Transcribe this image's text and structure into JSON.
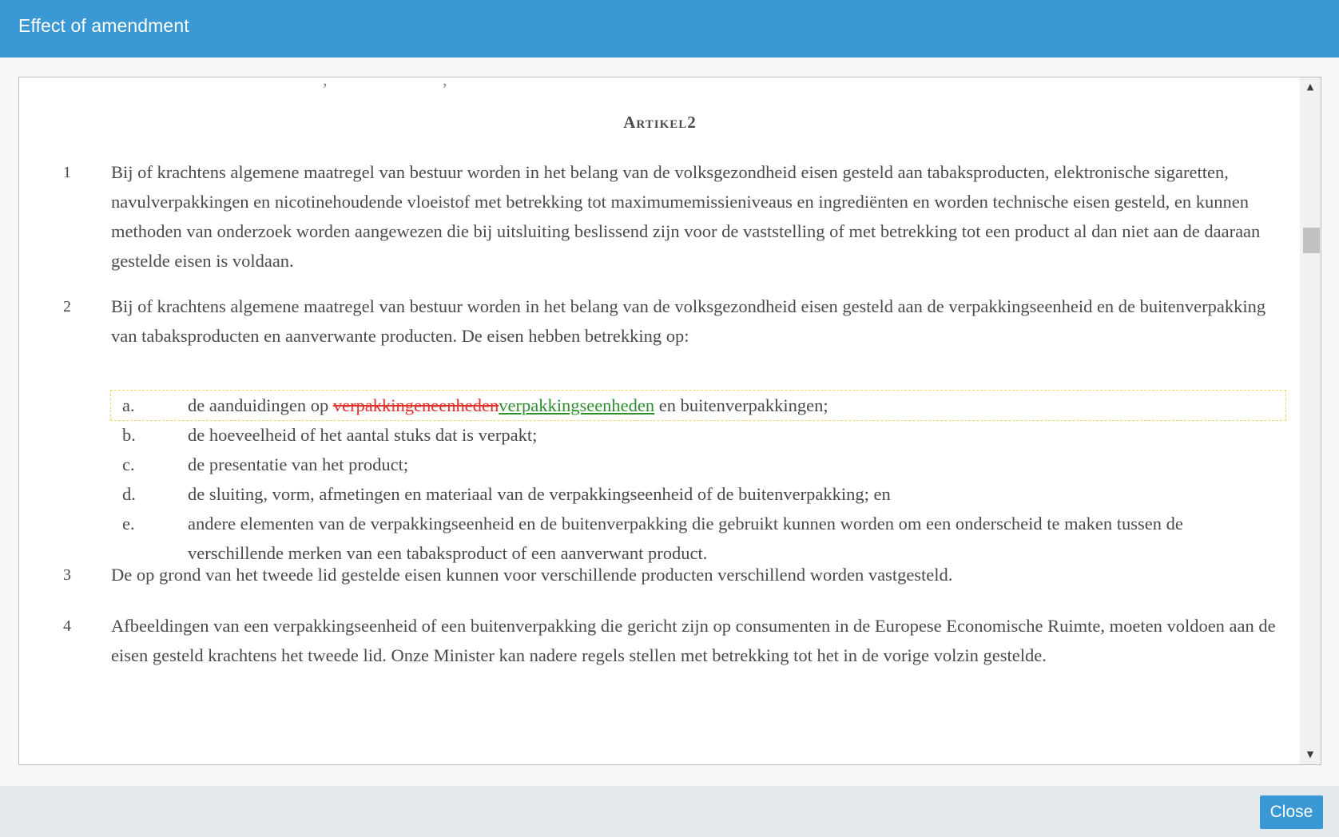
{
  "dialog": {
    "title": "Effect of amendment",
    "close_label": "Close"
  },
  "document": {
    "article_heading": "Artikel2",
    "members": [
      {
        "number": "1",
        "text": "Bij of krachtens algemene maatregel van bestuur worden in het belang van de volksgezondheid eisen gesteld aan tabaksproducten, elektronische sigaretten, navulverpakkingen en nicotinehoudende vloeistof met betrekking tot maximumemissieniveaus en ingrediënten en worden technische eisen gesteld, en kunnen methoden van onderzoek worden aangewezen die bij uitsluiting beslissend zijn voor de vaststelling of met betrekking tot een product al dan niet aan de daaraan gestelde eisen is voldaan."
      },
      {
        "number": "2",
        "text": "Bij of krachtens algemene maatregel van bestuur worden in het belang van de volksgezondheid eisen gesteld aan de verpakkingseenheid en de buitenverpakking van tabaksproducten en aanverwante producten. De eisen hebben betrekking op:",
        "items": [
          {
            "label": "a.",
            "prefix": "de aanduidingen op ",
            "deleted": "verpakkingeneenheden",
            "inserted": "verpakkingseenheden",
            "suffix": " en buitenverpakkingen;"
          },
          {
            "label": "b.",
            "text": "de hoeveelheid of het aantal stuks dat is verpakt;"
          },
          {
            "label": "c.",
            "text": "de presentatie van het product;"
          },
          {
            "label": "d.",
            "text": "de sluiting, vorm, afmetingen en materiaal van de verpakkingseenheid of de buitenverpakking; en"
          },
          {
            "label": "e.",
            "text": "andere elementen van de verpakkingseenheid en de buitenverpakking die gebruikt kunnen worden om een onderscheid te maken tussen de verschillende merken van een tabaksproduct of een aanverwant product."
          }
        ]
      },
      {
        "number": "3",
        "text": "De op grond van het tweede lid gestelde eisen kunnen voor verschillende producten verschillend worden vastgesteld."
      },
      {
        "number": "4",
        "text": "Afbeeldingen van een verpakkingseenheid of een buitenverpakking die gericht zijn op consumenten in de Europese Economische Ruimte, moeten voldoen aan de eisen gesteld krachtens het tweede lid. Onze Minister kan nadere regels stellen met betrekking tot het in de vorige volzin gestelde."
      }
    ]
  },
  "colors": {
    "header": "#3a98d5",
    "deleted_text": "#e0302b",
    "inserted_text": "#2f8f2f",
    "change_outline": "#f1d862"
  },
  "icons": {
    "scroll_up": "triangle-up-icon",
    "scroll_down": "triangle-down-icon"
  }
}
